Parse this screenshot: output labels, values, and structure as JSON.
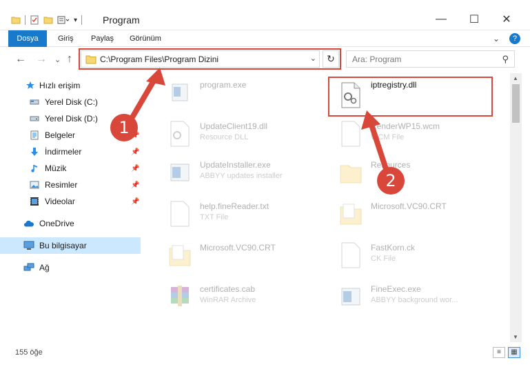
{
  "window": {
    "title": "Program",
    "minimize": "—",
    "maximize": "☐",
    "close": "✕"
  },
  "ribbon": {
    "tabs": [
      "Dosya",
      "Giriş",
      "Paylaş",
      "Görünüm"
    ],
    "collapse": "⌄",
    "help": "?"
  },
  "nav": {
    "back": "←",
    "forward": "→",
    "recent": "⌄",
    "up": "↑",
    "address": "C:\\Program Files\\Program Dizini",
    "address_chevron": "⌄",
    "refresh": "↻",
    "search_placeholder": "Ara: Program",
    "search_icon": "⚲"
  },
  "sidebar": {
    "items": [
      {
        "label": "Hızlı erişim",
        "icon": "star-icon"
      },
      {
        "label": "Yerel Disk (C:)",
        "icon": "drive-icon"
      },
      {
        "label": "Yerel Disk (D:)",
        "icon": "drive-icon"
      },
      {
        "label": "Belgeler",
        "icon": "documents-icon"
      },
      {
        "label": "İndirmeler",
        "icon": "download-icon"
      },
      {
        "label": "Müzik",
        "icon": "music-icon"
      },
      {
        "label": "Resimler",
        "icon": "pictures-icon"
      },
      {
        "label": "Videolar",
        "icon": "videos-icon"
      },
      {
        "label": "OneDrive",
        "icon": "cloud-icon"
      },
      {
        "label": "Bu bilgisayar",
        "icon": "computer-icon"
      },
      {
        "label": "Ağ",
        "icon": "network-icon"
      }
    ],
    "pin": "📌"
  },
  "files": [
    {
      "name": "program.exe",
      "type": ""
    },
    {
      "name": "iptregistry.dll",
      "type": ""
    },
    {
      "name": "UpdateClient19.dll",
      "type": "Resource DLL"
    },
    {
      "name": "RenderWP15.wcm",
      "type": "WCM File"
    },
    {
      "name": "UpdateInstaller.exe",
      "type": "ABBYY updates installer"
    },
    {
      "name": "Resources",
      "type": ""
    },
    {
      "name": "help.fineReader.txt",
      "type": "TXT File"
    },
    {
      "name": "Microsoft.VC90.CRT",
      "type": ""
    },
    {
      "name": "Microsoft.VC90.CRT",
      "type": ""
    },
    {
      "name": "FastKorn.ck",
      "type": "CK File"
    },
    {
      "name": "certificates.cab",
      "type": "WinRAR Archive"
    },
    {
      "name": "FineExec.exe",
      "type": "ABBYY background wor..."
    }
  ],
  "status": {
    "count": "155 öğe"
  },
  "callouts": [
    "1",
    "2"
  ]
}
